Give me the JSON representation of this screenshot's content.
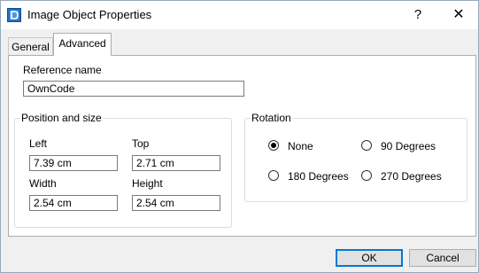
{
  "window": {
    "title": "Image Object Properties",
    "help_glyph": "?",
    "close_glyph": "✕"
  },
  "tabs": [
    {
      "label": "General",
      "active": false
    },
    {
      "label": "Advanced",
      "active": true
    }
  ],
  "reference": {
    "label": "Reference name",
    "value": "OwnCode"
  },
  "position": {
    "title": "Position and size",
    "left_label": "Left",
    "left_value": "7.39 cm",
    "top_label": "Top",
    "top_value": "2.71 cm",
    "width_label": "Width",
    "width_value": "2.54 cm",
    "height_label": "Height",
    "height_value": "2.54 cm"
  },
  "rotation": {
    "title": "Rotation",
    "options": [
      {
        "label": "None",
        "checked": true
      },
      {
        "label": "90 Degrees",
        "checked": false
      },
      {
        "label": "180 Degrees",
        "checked": false
      },
      {
        "label": "270 Degrees",
        "checked": false
      }
    ]
  },
  "buttons": {
    "ok": "OK",
    "cancel": "Cancel"
  },
  "colors": {
    "app_icon": "#1e72c8",
    "default_button_border": "#0078d7"
  }
}
